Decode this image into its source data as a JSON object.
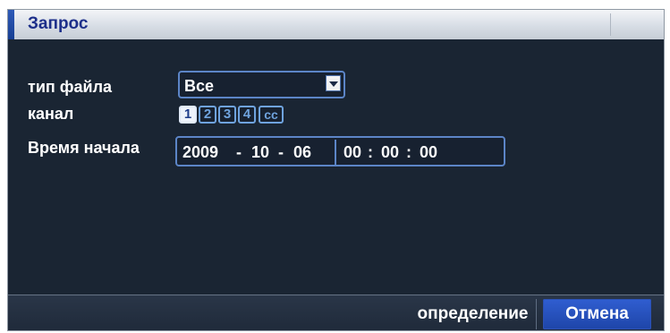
{
  "dialog": {
    "title": "Запрос",
    "file_type": {
      "label": "тип файла",
      "value": "Все"
    },
    "channel": {
      "label": "канал",
      "items": [
        "1",
        "2",
        "3",
        "4"
      ],
      "more": "сс"
    },
    "start_time": {
      "label": "Время начала",
      "date": {
        "year": "2009",
        "month": "10",
        "day": "06",
        "sep": "-"
      },
      "time": {
        "hour": "00",
        "minute": "00",
        "second": "00",
        "sep": ":"
      }
    },
    "buttons": {
      "ok": "определение",
      "cancel": "Отмена"
    }
  },
  "colors": {
    "panel_bg": "#1a2533",
    "field_border": "#5c85c7",
    "accent": "#2f5bb8",
    "title_text": "#1d2f8a"
  }
}
